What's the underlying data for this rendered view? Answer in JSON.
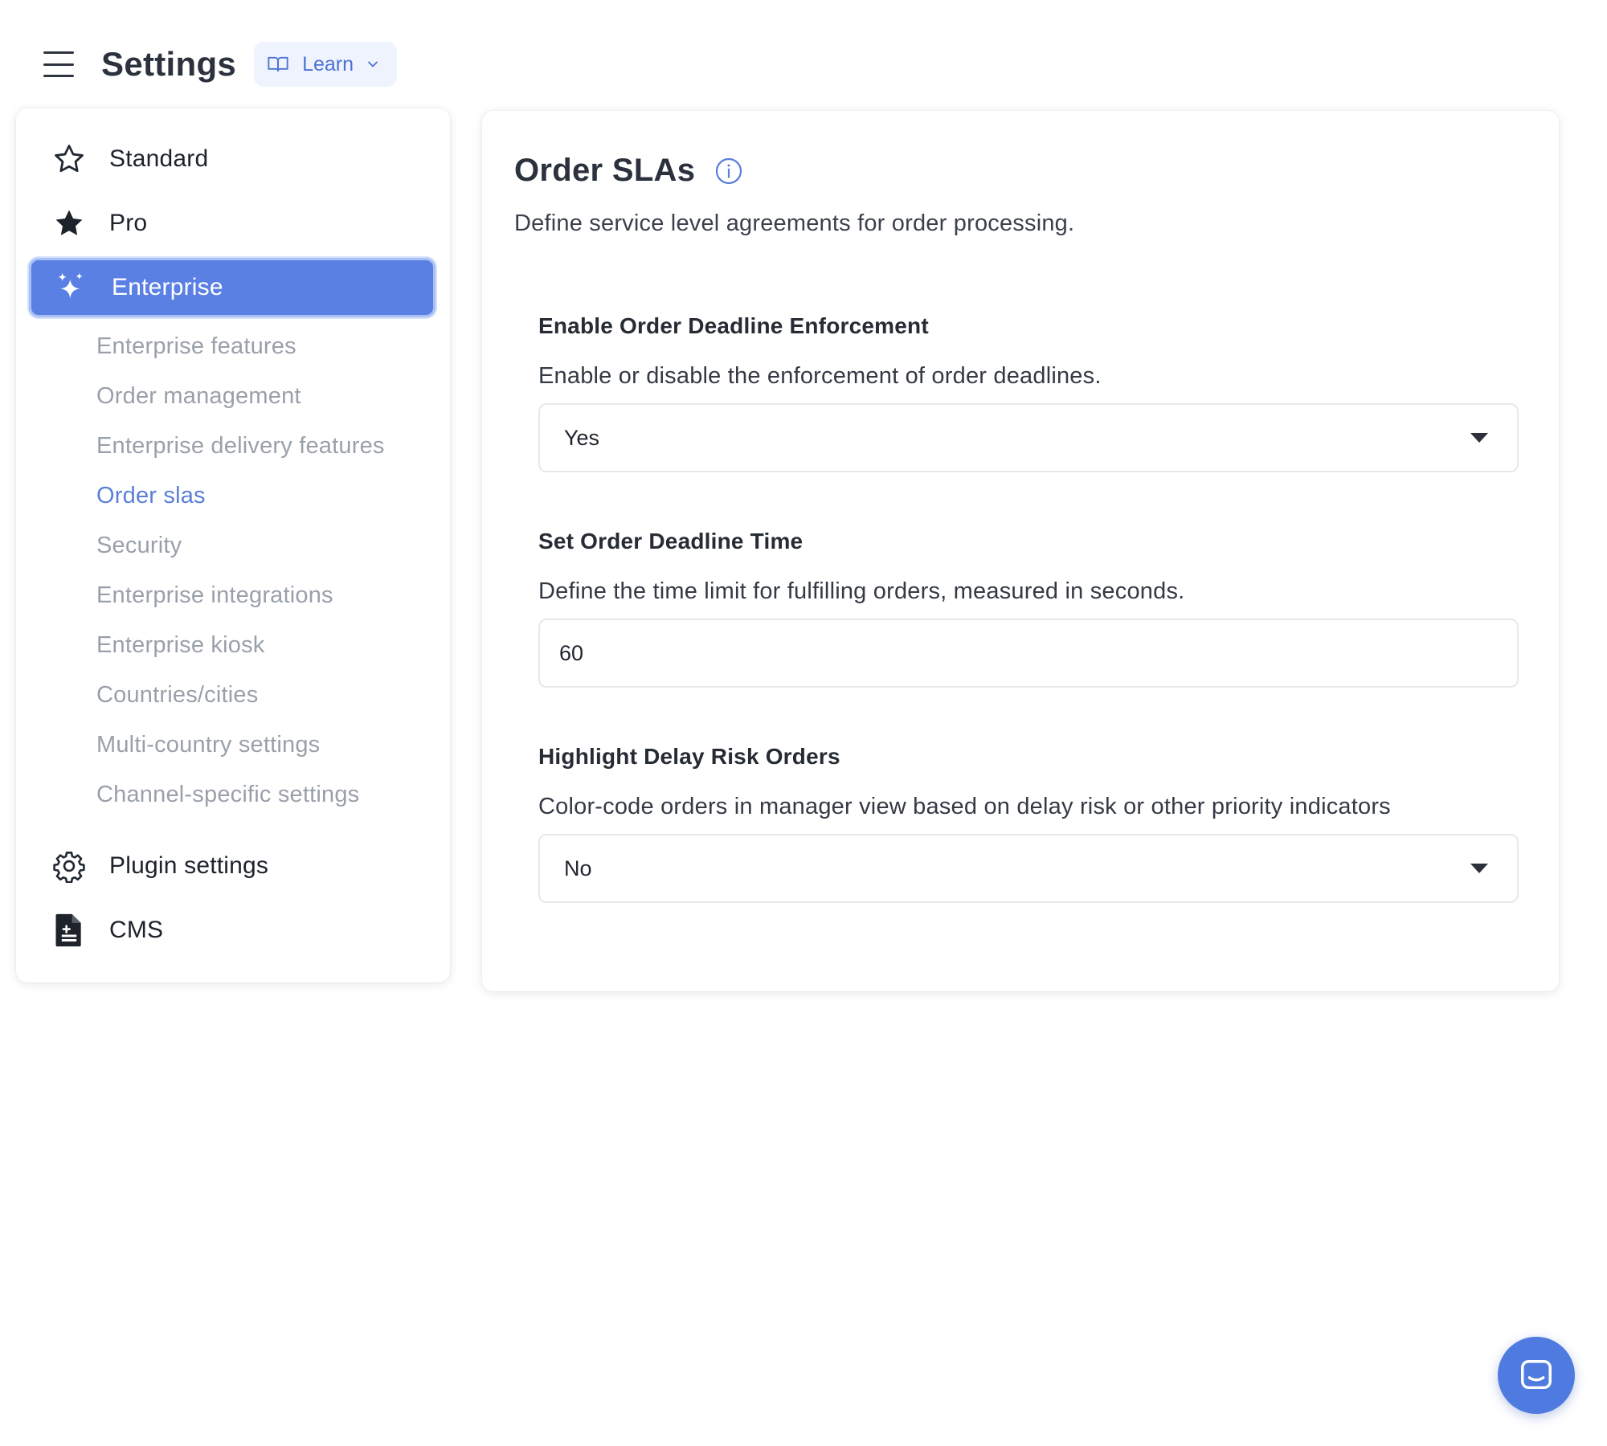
{
  "header": {
    "title": "Settings",
    "learn_label": "Learn"
  },
  "sidebar": {
    "items": [
      {
        "label": "Standard",
        "icon": "star-outline-icon"
      },
      {
        "label": "Pro",
        "icon": "star-filled-icon"
      },
      {
        "label": "Enterprise",
        "icon": "sparkles-icon",
        "active": true
      },
      {
        "label": "Plugin settings",
        "icon": "gear-icon"
      },
      {
        "label": "CMS",
        "icon": "document-icon"
      }
    ],
    "enterprise_subitems": [
      "Enterprise features",
      "Order management",
      "Enterprise delivery features",
      "Order slas",
      "Security",
      "Enterprise integrations",
      "Enterprise kiosk",
      "Countries/cities",
      "Multi-country settings",
      "Channel-specific settings"
    ],
    "current_subitem": "Order slas"
  },
  "main": {
    "title": "Order SLAs",
    "description": "Define service level agreements for order processing.",
    "fields": [
      {
        "label": "Enable Order Deadline Enforcement",
        "help": "Enable or disable the enforcement of order deadlines.",
        "type": "select",
        "value": "Yes"
      },
      {
        "label": "Set Order Deadline Time",
        "help": "Define the time limit for fulfilling orders, measured in seconds.",
        "type": "number",
        "value": "60"
      },
      {
        "label": "Highlight Delay Risk Orders",
        "help": "Color-code orders in manager view based on delay risk or other priority indicators",
        "type": "select",
        "value": "No"
      }
    ]
  },
  "colors": {
    "accent": "#5b80e4",
    "accent_light": "#eef3fd",
    "link": "#5b7fd8",
    "muted_text": "#9aa0aa",
    "chat_button": "#4f7be0"
  }
}
